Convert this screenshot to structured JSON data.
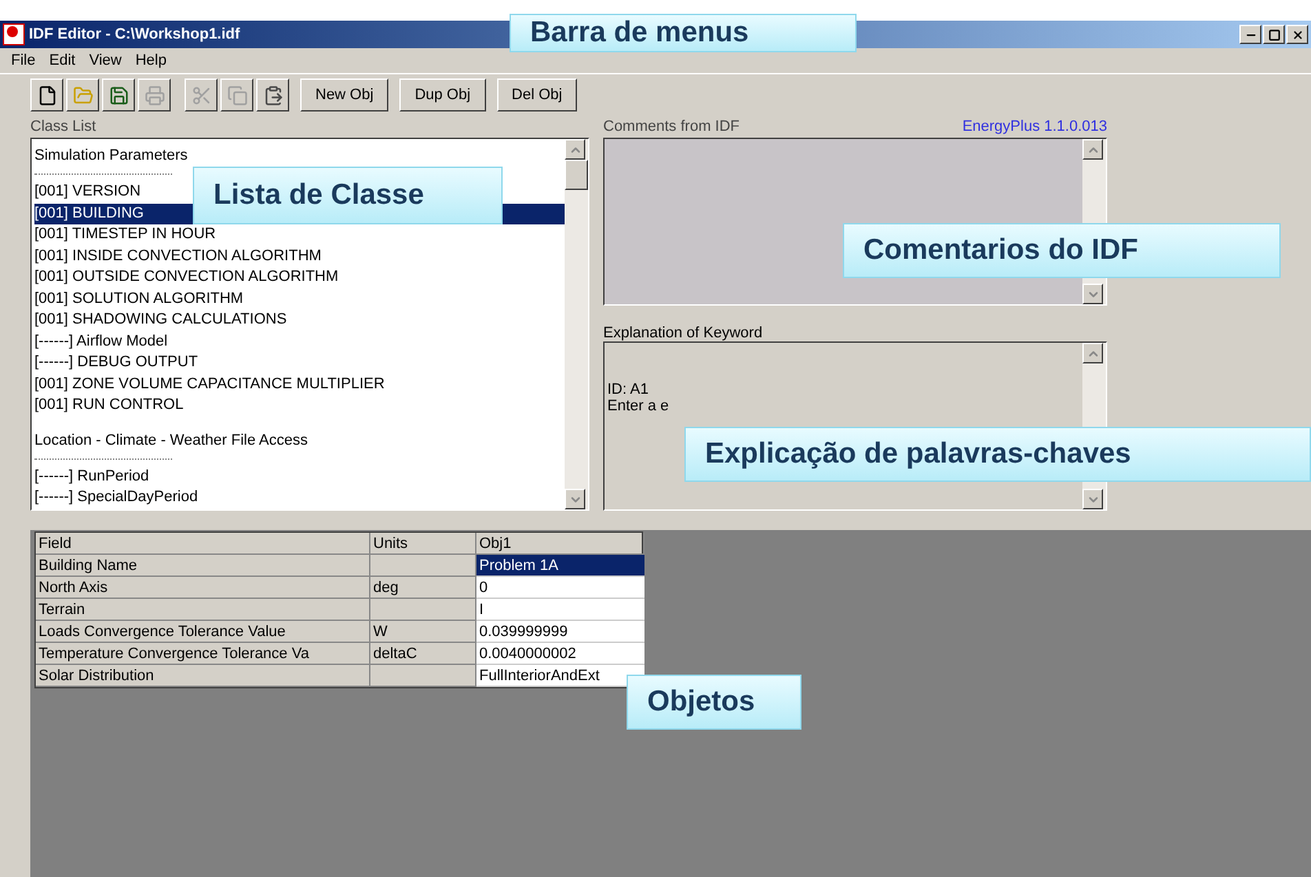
{
  "window": {
    "title": "IDF Editor - C:\\Workshop1.idf"
  },
  "menu": [
    "File",
    "Edit",
    "View",
    "Help"
  ],
  "toolbar": [
    {
      "kind": "new",
      "disabled": false
    },
    {
      "kind": "open",
      "disabled": false
    },
    {
      "kind": "save",
      "disabled": false
    },
    {
      "kind": "print",
      "disabled": true
    },
    {
      "kind": "cut",
      "disabled": true
    },
    {
      "kind": "copy",
      "disabled": true
    },
    {
      "kind": "paste",
      "disabled": false
    },
    {
      "kind": "text",
      "label": "New Obj",
      "disabled": false
    },
    {
      "kind": "text",
      "label": "Dup Obj",
      "disabled": false
    },
    {
      "kind": "text",
      "label": "Del Obj",
      "disabled": false
    }
  ],
  "class_list": {
    "label": "Class List",
    "items": [
      {
        "kind": "header",
        "text": "Simulation Parameters"
      },
      {
        "kind": "class",
        "text": "[001] VERSION",
        "selected": false
      },
      {
        "kind": "class",
        "text": "[001] BUILDING",
        "selected": true
      },
      {
        "kind": "class",
        "text": "[001] TIMESTEP IN HOUR",
        "selected": false
      },
      {
        "kind": "class",
        "text": "[001] INSIDE CONVECTION ALGORITHM",
        "selected": false
      },
      {
        "kind": "class",
        "text": "[001] OUTSIDE CONVECTION ALGORITHM",
        "selected": false
      },
      {
        "kind": "class",
        "text": "[001] SOLUTION ALGORITHM",
        "selected": false
      },
      {
        "kind": "class",
        "text": "[001] SHADOWING CALCULATIONS",
        "selected": false
      },
      {
        "kind": "class",
        "text": "[------] Airflow Model",
        "selected": false
      },
      {
        "kind": "class",
        "text": "[------] DEBUG OUTPUT",
        "selected": false
      },
      {
        "kind": "class",
        "text": "[001] ZONE VOLUME CAPACITANCE MULTIPLIER",
        "selected": false
      },
      {
        "kind": "class",
        "text": "[001] RUN CONTROL",
        "selected": false
      },
      {
        "kind": "header",
        "text": "Location - Climate - Weather File Access"
      },
      {
        "kind": "class",
        "text": "[------] RunPeriod",
        "selected": false
      },
      {
        "kind": "class",
        "text": "[------] SpecialDayPeriod",
        "selected": false
      }
    ]
  },
  "comments": {
    "label": "Comments from IDF",
    "version": "EnergyPlus 1.1.0.013"
  },
  "explanation": {
    "label": "Explanation of Keyword",
    "lines": [
      "ID: A1",
      "Enter a e"
    ]
  },
  "table": {
    "columns": [
      "Field",
      "Units",
      "Obj1"
    ],
    "rows": [
      {
        "field": "Building Name",
        "units": "",
        "value": "Problem 1A",
        "selected": true
      },
      {
        "field": "North Axis",
        "units": "deg",
        "value": "0",
        "selected": false
      },
      {
        "field": "Terrain",
        "units": "",
        "value": "I",
        "selected": false
      },
      {
        "field": "Loads Convergence Tolerance Value",
        "units": "W",
        "value": "0.039999999",
        "selected": false
      },
      {
        "field": "Temperature Convergence Tolerance Va",
        "units": "deltaC",
        "value": "0.0040000002",
        "selected": false
      },
      {
        "field": "Solar Distribution",
        "units": "",
        "value": "FullInteriorAndExt",
        "selected": false
      }
    ]
  },
  "callouts": [
    {
      "kind": "menus",
      "text": "Barra de menus"
    },
    {
      "kind": "classes",
      "text": "Lista de Classe"
    },
    {
      "kind": "comments",
      "text": "Comentarios do IDF"
    },
    {
      "kind": "keywords",
      "text": "Explicação de palavras-chaves"
    },
    {
      "kind": "objects",
      "text": "Objetos"
    }
  ]
}
